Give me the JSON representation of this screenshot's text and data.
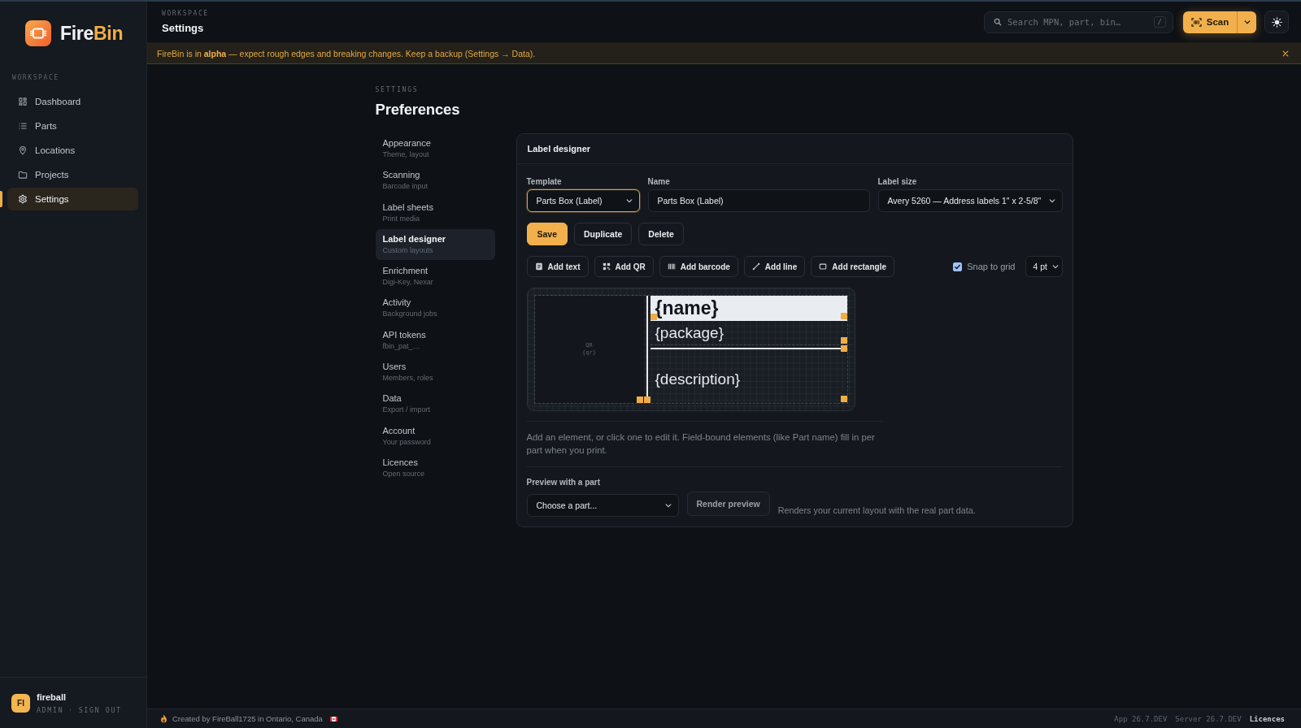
{
  "sidebar": {
    "logo": {
      "name_start": "Fire",
      "name_end": "Bin"
    },
    "section_label": "WORKSPACE",
    "items": [
      {
        "label": "Dashboard",
        "selected": false
      },
      {
        "label": "Parts",
        "selected": false
      },
      {
        "label": "Locations",
        "selected": false
      },
      {
        "label": "Projects",
        "selected": false
      },
      {
        "label": "Settings",
        "selected": true
      }
    ],
    "user": {
      "initials": "FI",
      "name": "fireball",
      "role": "ADMIN",
      "separator": "·",
      "action": "SIGN OUT"
    }
  },
  "header": {
    "breadcrumb": "WORKSPACE",
    "title": "Settings",
    "search": {
      "placeholder": "Search MPN, part, bin…",
      "shortcut": "/"
    },
    "scan": "Scan"
  },
  "banner": {
    "text": "FireBin is in **alpha** — expect rough edges and breaking changes. Keep a backup (Settings → Data)."
  },
  "settings": {
    "eyebrow": "SETTINGS",
    "title": "Preferences",
    "nav": [
      {
        "label": "Appearance",
        "detail": "Theme, layout",
        "selected": false
      },
      {
        "label": "Scanning",
        "detail": "Barcode input",
        "selected": false
      },
      {
        "label": "Label sheets",
        "detail": "Print media",
        "selected": false
      },
      {
        "label": "Label designer",
        "detail": "Custom layouts",
        "selected": true
      },
      {
        "label": "Enrichment",
        "detail": "Digi-Key, Nexar",
        "selected": false
      },
      {
        "label": "Activity",
        "detail": "Background jobs",
        "selected": false
      },
      {
        "label": "API tokens",
        "detail": "fbin_pat_…",
        "selected": false
      },
      {
        "label": "Users",
        "detail": "Members, roles",
        "selected": false
      },
      {
        "label": "Data",
        "detail": "Export / import",
        "selected": false
      },
      {
        "label": "Account",
        "detail": "Your password",
        "selected": false
      },
      {
        "label": "Licences",
        "detail": "Open source",
        "selected": false
      }
    ]
  },
  "designer": {
    "title": "Label designer",
    "fields": [
      {
        "kind": "select",
        "label": "Template",
        "value": "Parts Box (Label)",
        "focused": true
      },
      {
        "kind": "text",
        "label": "Name",
        "value": "Parts Box (Label)",
        "focused": false
      },
      {
        "kind": "select",
        "label": "Label size",
        "value": "Avery 5260 — Address labels 1\" x 2-5/8\"",
        "focused": false
      }
    ],
    "actions": [
      {
        "label": "Save",
        "kind": "primary"
      },
      {
        "label": "Duplicate",
        "kind": "secondary"
      },
      {
        "label": "Delete",
        "kind": "secondary"
      }
    ],
    "tools": [
      "Add text",
      "Add QR",
      "Add barcode",
      "Add line",
      "Add rectangle"
    ],
    "snap": {
      "label": "Snap to grid",
      "checked": true,
      "step": "4 pt"
    },
    "canvas": {
      "qr": {
        "label": "QR",
        "field": "{qr}"
      },
      "vertical_line": true,
      "elements": [
        {
          "kind": "text",
          "text": "{name}",
          "bold": true,
          "inverted": true
        },
        {
          "kind": "text",
          "text": "{package}",
          "bold": false,
          "inverted": false
        },
        {
          "kind": "line"
        },
        {
          "kind": "text",
          "text": "{description}",
          "bold": false,
          "inverted": false
        }
      ]
    },
    "help": "Add an element, or click one to edit it. Field-bound elements (like Part name) fill in per part when you print.",
    "preview": {
      "label": "Preview with a part",
      "placeholder": "Choose a part...",
      "button": "Render preview",
      "button_disabled": true,
      "note": "Renders your current layout with the real part data."
    }
  },
  "footer": {
    "credit": "Created by FireBall1725 in Ontario, Canada",
    "versions": [
      "App 26.7.DEV",
      "Server 26.7.DEV"
    ],
    "link": "Licences"
  }
}
